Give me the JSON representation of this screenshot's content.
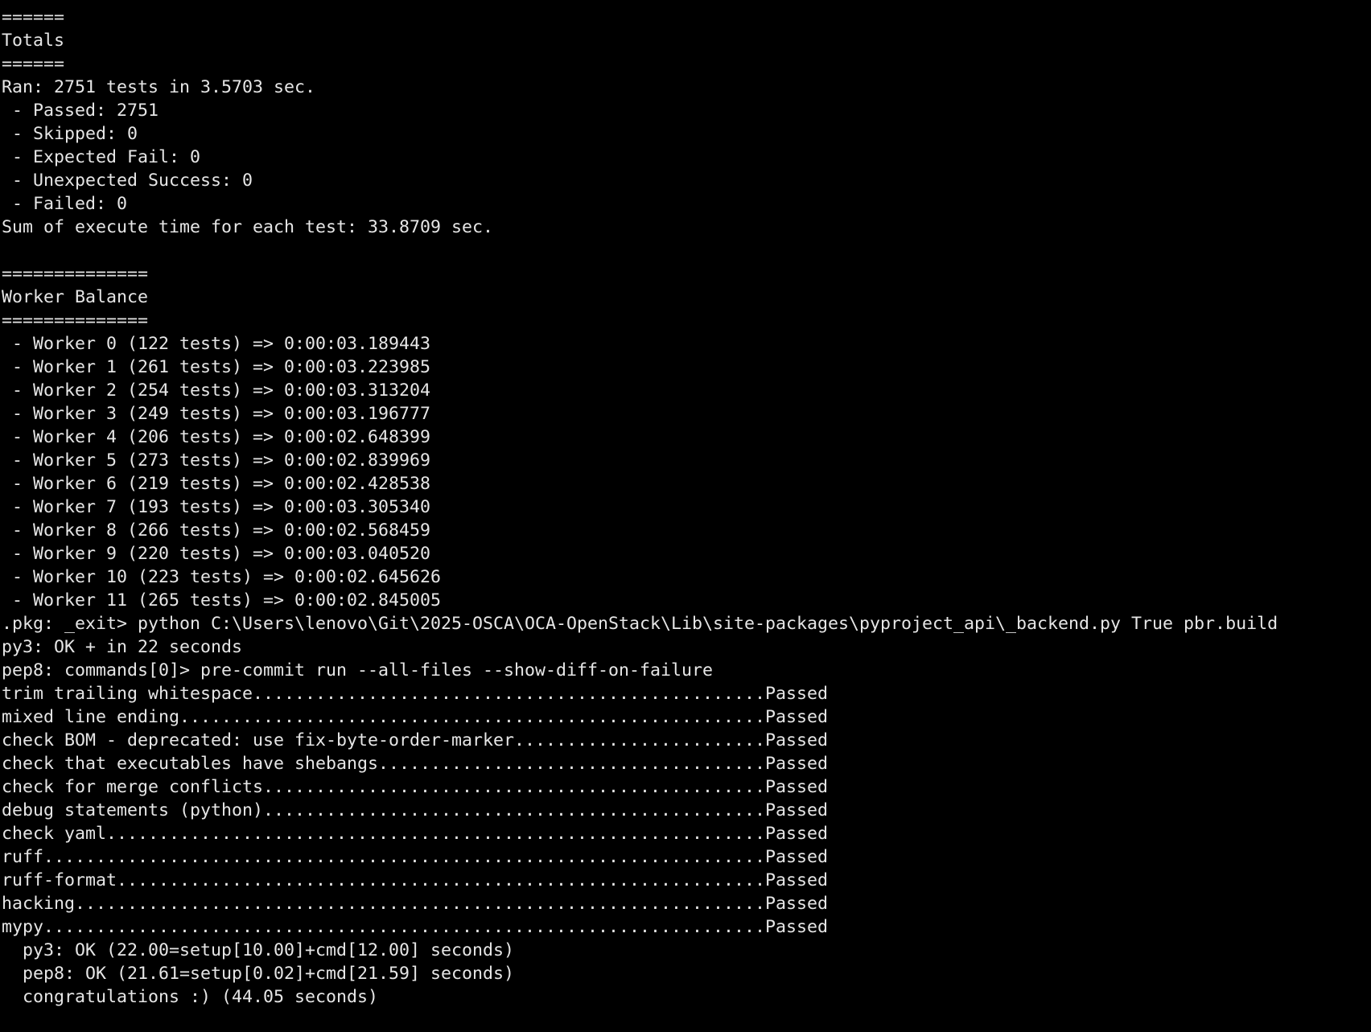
{
  "terminal": {
    "lines": [
      "======",
      "Totals",
      "======",
      "Ran: 2751 tests in 3.5703 sec.",
      " - Passed: 2751",
      " - Skipped: 0",
      " - Expected Fail: 0",
      " - Unexpected Success: 0",
      " - Failed: 0",
      "Sum of execute time for each test: 33.8709 sec.",
      "",
      "==============",
      "Worker Balance",
      "==============",
      " - Worker 0 (122 tests) => 0:00:03.189443",
      " - Worker 1 (261 tests) => 0:00:03.223985",
      " - Worker 2 (254 tests) => 0:00:03.313204",
      " - Worker 3 (249 tests) => 0:00:03.196777",
      " - Worker 4 (206 tests) => 0:00:02.648399",
      " - Worker 5 (273 tests) => 0:00:02.839969",
      " - Worker 6 (219 tests) => 0:00:02.428538",
      " - Worker 7 (193 tests) => 0:00:03.305340",
      " - Worker 8 (266 tests) => 0:00:02.568459",
      " - Worker 9 (220 tests) => 0:00:03.040520",
      " - Worker 10 (223 tests) => 0:00:02.645626",
      " - Worker 11 (265 tests) => 0:00:02.845005",
      ".pkg: _exit> python C:\\Users\\lenovo\\Git\\2025-OSCA\\OCA-OpenStack\\Lib\\site-packages\\pyproject_api\\_backend.py True pbr.build",
      "py3: OK + in 22 seconds",
      "pep8: commands[0]> pre-commit run --all-files --show-diff-on-failure",
      "trim trailing whitespace.................................................Passed",
      "mixed line ending........................................................Passed",
      "check BOM - deprecated: use fix-byte-order-marker........................Passed",
      "check that executables have shebangs.....................................Passed",
      "check for merge conflicts................................................Passed",
      "debug statements (python)................................................Passed",
      "check yaml...............................................................Passed",
      "ruff.....................................................................Passed",
      "ruff-format..............................................................Passed",
      "hacking..................................................................Passed",
      "mypy.....................................................................Passed",
      "  py3: OK (22.00=setup[10.00]+cmd[12.00] seconds)",
      "  pep8: OK (21.61=setup[0.02]+cmd[21.59] seconds)",
      "  congratulations :) (44.05 seconds)"
    ]
  }
}
